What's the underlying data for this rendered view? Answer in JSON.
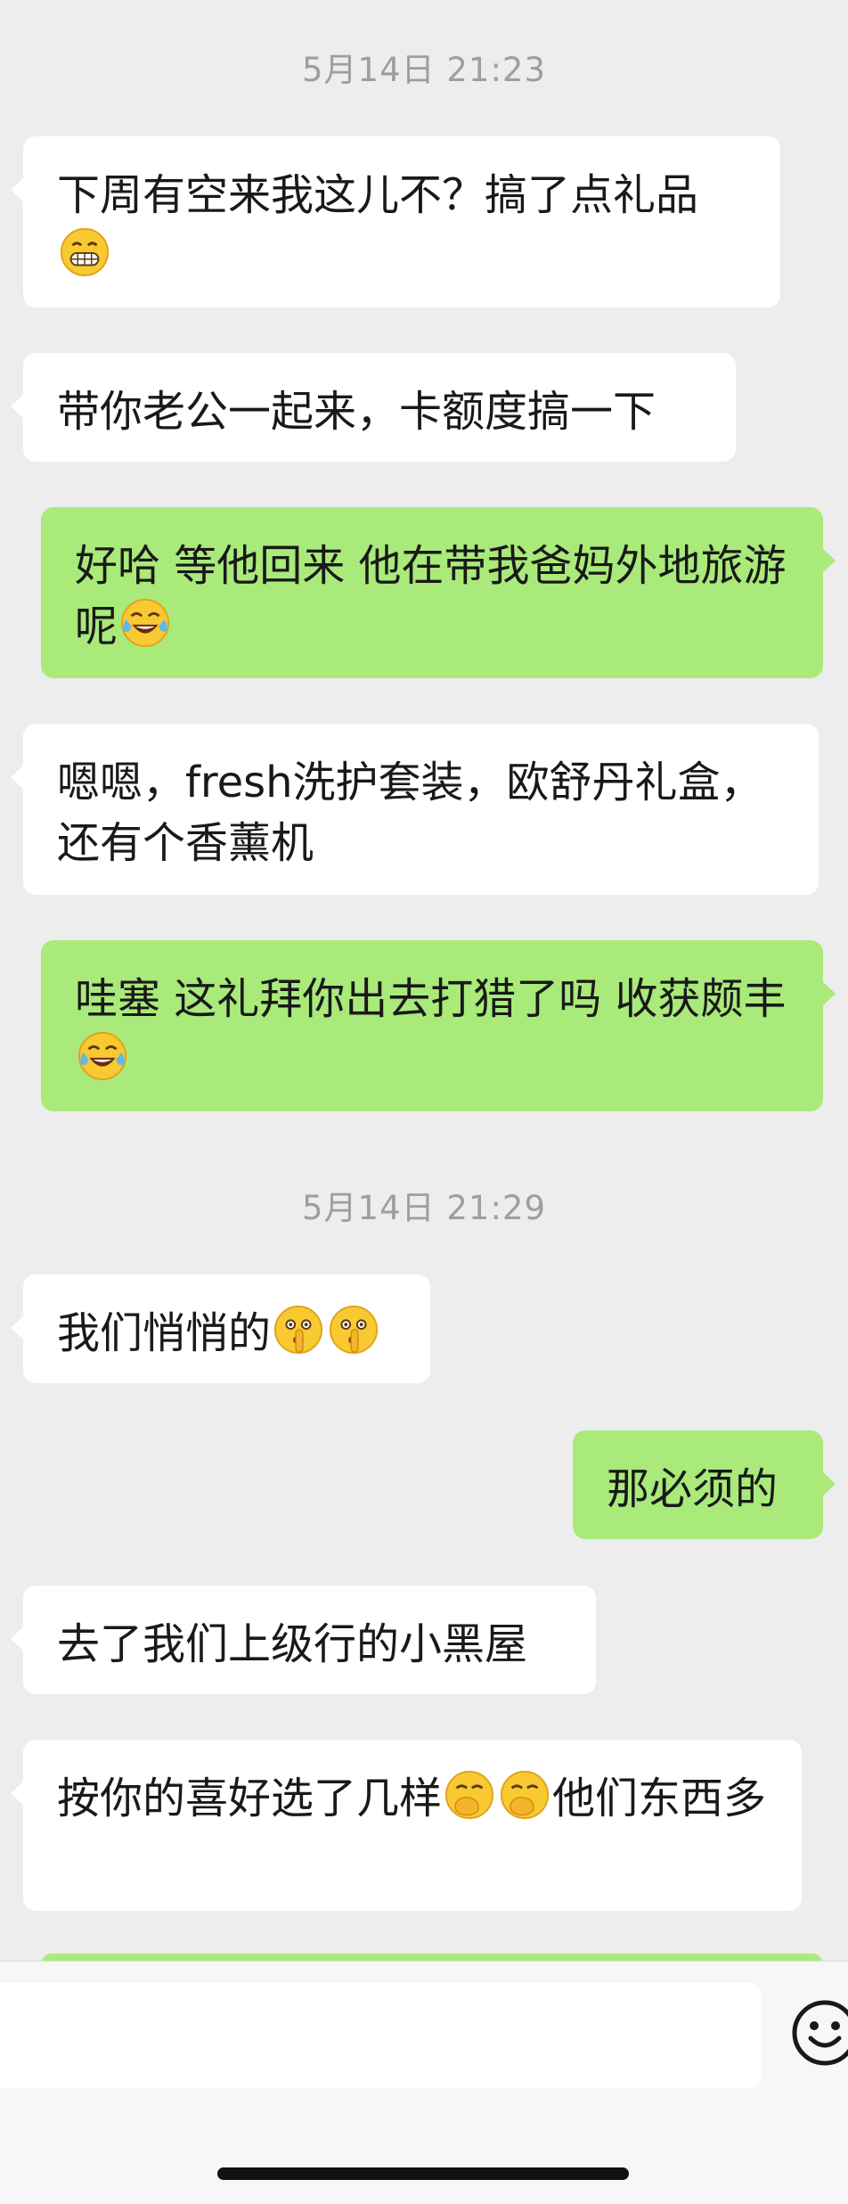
{
  "chat": {
    "timestamps": [
      "5月14日 21:23",
      "5月14日 21:29"
    ],
    "messages": [
      {
        "side": "in",
        "text": "下周有空来我这儿不？搞了点礼品",
        "emoji_after": [
          "grinning-face"
        ]
      },
      {
        "side": "in",
        "text": "带你老公一起来，卡额度搞一下"
      },
      {
        "side": "out",
        "text": "好哈 等他回来 他在带我爸妈外地旅游呢",
        "emoji_after": [
          "tears-of-joy"
        ]
      },
      {
        "side": "in",
        "text": "嗯嗯，fresh洗护套装，欧舒丹礼盒，还有个香薰机"
      },
      {
        "side": "out",
        "text": "哇塞 这礼拜你出去打猎了吗 收获颇丰",
        "emoji_after": [
          "tears-of-joy"
        ]
      },
      {
        "side": "in",
        "text": "我们悄悄的",
        "emoji_after": [
          "shushing-face",
          "shushing-face"
        ]
      },
      {
        "side": "out",
        "text": "那必须的"
      },
      {
        "side": "in",
        "text": "去了我们上级行的小黑屋"
      },
      {
        "side": "in",
        "text_before": "按你的喜好选了几样",
        "emoji_mid": [
          "hand-over-mouth",
          "hand-over-mouth"
        ],
        "text_after": "他们东西多"
      }
    ]
  },
  "input_bar": {
    "value": "",
    "emoji_button_icon": "smiley-icon"
  },
  "colors": {
    "background": "#ededed",
    "incoming_bubble": "#ffffff",
    "outgoing_bubble": "#a9ea7a",
    "timestamp_text": "#9e9e9e"
  }
}
